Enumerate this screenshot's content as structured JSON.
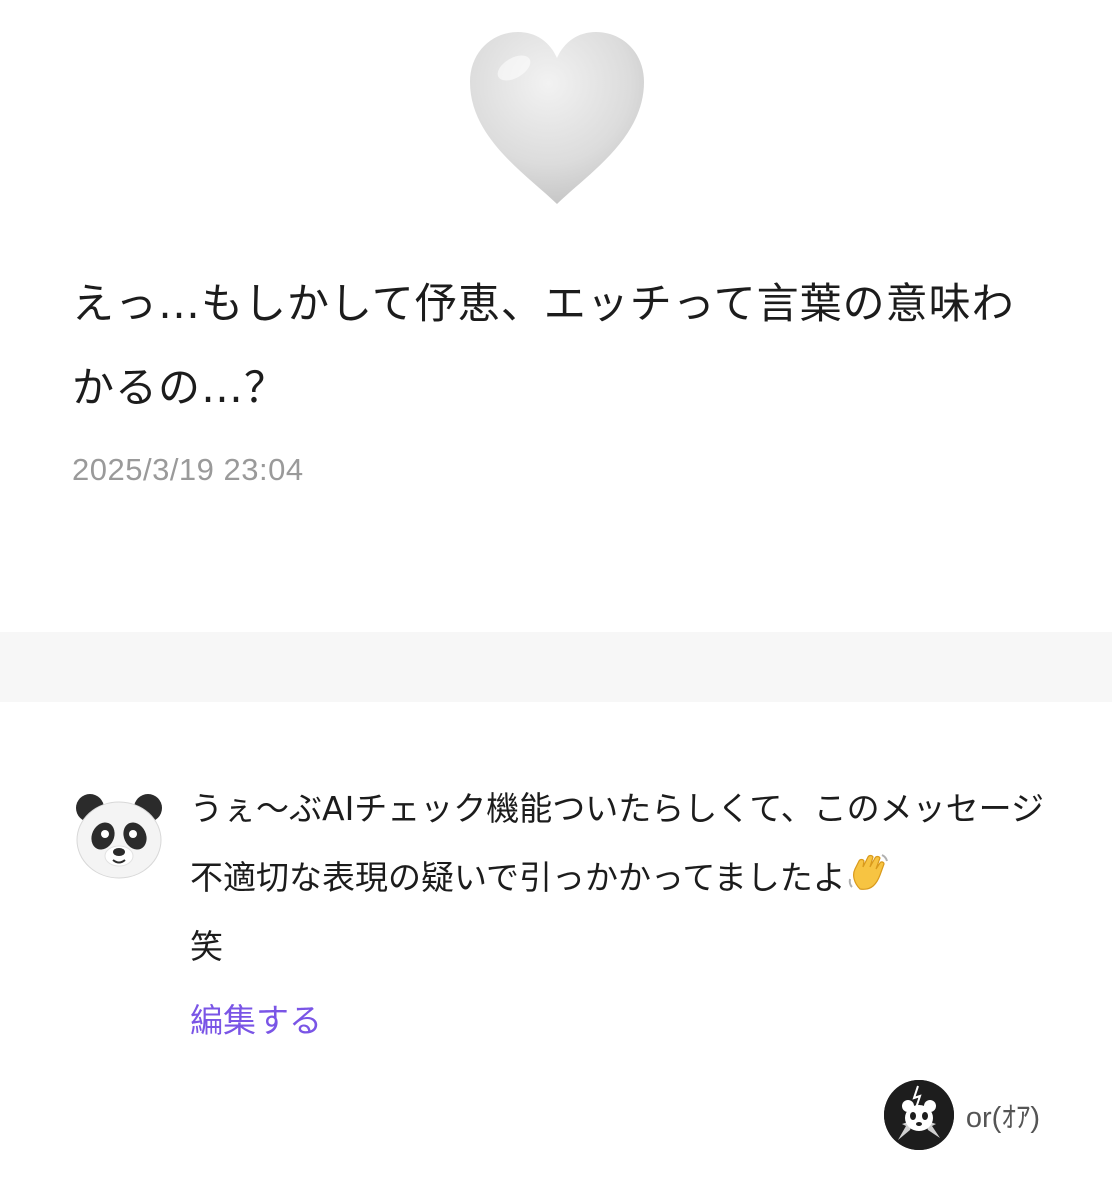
{
  "post": {
    "icon": "white-heart-icon",
    "text": "えっ…もしかして伃恵、エッチって言葉の意味わかるの…？",
    "timestamp": "2025/3/19 23:04"
  },
  "reply": {
    "avatar_icon": "panda-face-icon",
    "text_main": "うぇ〜ぶAIチェック機能ついたらしくて、このメッセージ不適切な表現の疑いで引っかかってましたよ",
    "wave_icon": "waving-hand-icon",
    "text_tail": "笑",
    "edit_label": "編集する"
  },
  "author": {
    "name": "or(ｵｱ)"
  },
  "colors": {
    "link": "#7a55e6",
    "timestamp": "#9a9a9a",
    "divider": "#f7f7f7"
  }
}
